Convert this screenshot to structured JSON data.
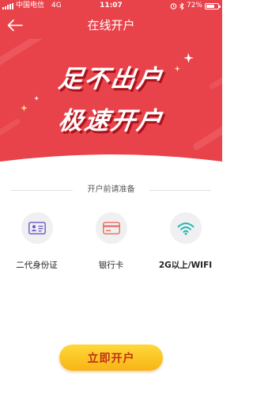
{
  "status_bar": {
    "carrier": "中国电信",
    "network": "4G",
    "time": "11:07",
    "battery": "72%",
    "battery_level": 0.72
  },
  "nav": {
    "title": "在线开户",
    "back_icon": "arrow-left-icon"
  },
  "banner": {
    "line1": "足不出户",
    "line2": "极速开户"
  },
  "prep": {
    "title": "开户前请准备",
    "items": [
      {
        "label": "二代身份证",
        "icon": "id-card-icon"
      },
      {
        "label": "银行卡",
        "icon": "bank-card-icon"
      },
      {
        "label": "2G以上/WIFI",
        "icon": "wifi-icon"
      }
    ]
  },
  "action": {
    "button_label": "立即开户"
  },
  "colors": {
    "header_red": "#e8424a",
    "id_card_purple": "#6a5bc4",
    "bank_card_red": "#e86a5a",
    "wifi_teal": "#27b7b3",
    "button_yellow": "#fcc52a",
    "button_text": "#c03018"
  }
}
